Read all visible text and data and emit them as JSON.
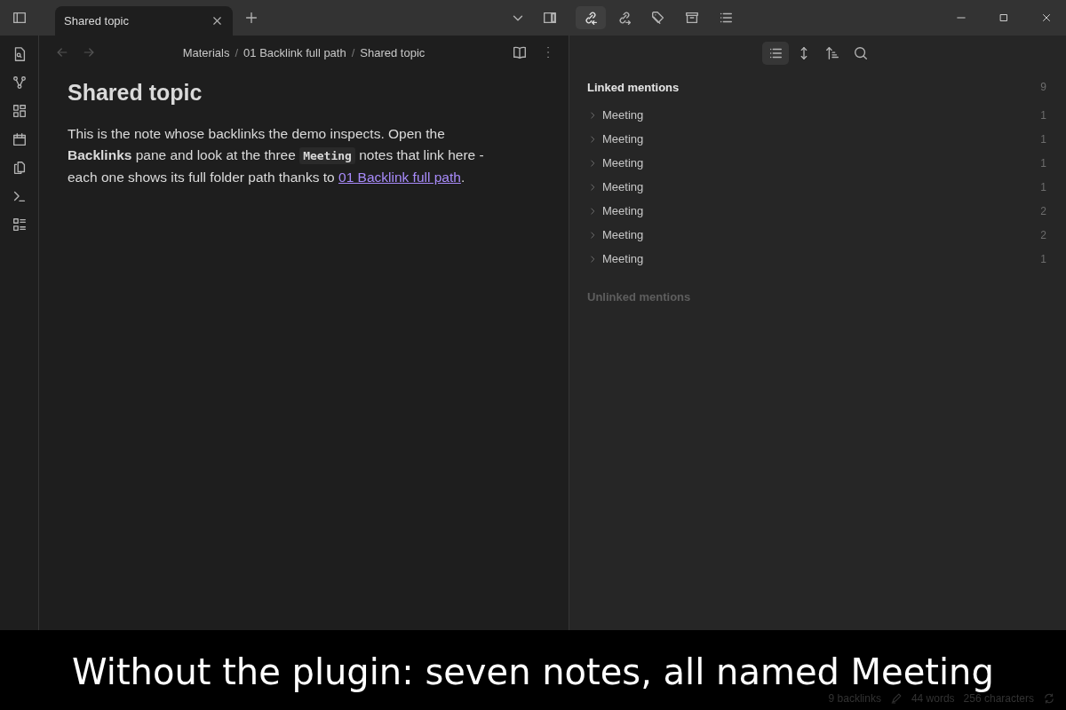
{
  "tabs": [
    {
      "label": "Shared topic",
      "selected": true
    }
  ],
  "side_tabs": [
    {
      "kind": "backlinks",
      "selected": true
    },
    {
      "kind": "outgoing",
      "selected": false
    },
    {
      "kind": "tags",
      "selected": false
    },
    {
      "kind": "archive",
      "selected": false
    },
    {
      "kind": "outline",
      "selected": false
    }
  ],
  "breadcrumb": [
    "Materials",
    "01 Backlink full path",
    "Shared topic"
  ],
  "breadcrumb_separator": "/",
  "note": {
    "title": "Shared topic",
    "paragraph": [
      {
        "kind": "text",
        "text": "This is the note whose backlinks the demo inspects. Open the **Backlinks** pane and look at the three "
      },
      {
        "kind": "code",
        "text": "Meeting"
      },
      {
        "kind": "text",
        "text": " notes that link here - each one shows its full folder path thanks to "
      },
      {
        "kind": "link",
        "text": "01 Backlink full path"
      },
      {
        "kind": "text",
        "text": "."
      }
    ]
  },
  "pane_tools": [
    {
      "kind": "list",
      "selected": true
    },
    {
      "kind": "expand",
      "selected": false
    },
    {
      "kind": "sort",
      "selected": false
    },
    {
      "kind": "search",
      "selected": false
    }
  ],
  "linked_mentions": {
    "title": "Linked mentions",
    "count": "9",
    "items": [
      {
        "name": "Meeting",
        "count": "1",
        "expanded": false
      },
      {
        "name": "Meeting",
        "count": "1",
        "expanded": false
      },
      {
        "name": "Meeting",
        "count": "1",
        "expanded": false
      },
      {
        "name": "Meeting",
        "count": "1",
        "expanded": false
      },
      {
        "name": "Meeting",
        "count": "2",
        "expanded": false
      },
      {
        "name": "Meeting",
        "count": "2",
        "expanded": false
      },
      {
        "name": "Meeting",
        "count": "1",
        "expanded": false
      }
    ]
  },
  "unlinked_mentions": {
    "title": "Unlinked mentions"
  },
  "status_bar": {
    "backlinks": "9 backlinks",
    "words": "44 words",
    "characters": "256 characters"
  },
  "caption": "Without the plugin: seven notes, all named Meeting"
}
